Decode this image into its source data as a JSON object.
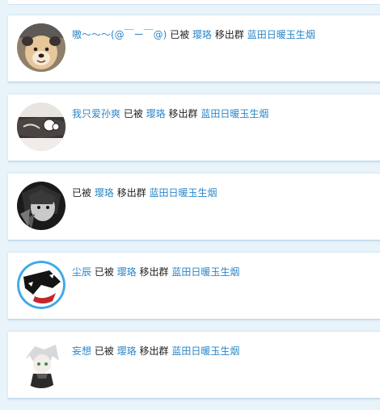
{
  "notifications": [
    {
      "user": "嗷～～～(@￣ー￣@)",
      "verb_removed": "已被",
      "admin": "璎珞",
      "action": "移出群",
      "group": "蓝田日暖玉生烟",
      "avatar": "dog-avatar"
    },
    {
      "user": "我只爱孙爽",
      "verb_removed": "已被",
      "admin": "璎珞",
      "action": "移出群",
      "group": "蓝田日暖玉生烟",
      "avatar": "anime-avatar"
    },
    {
      "user": "",
      "verb_removed": "已被",
      "admin": "璎珞",
      "action": "移出群",
      "group": "蓝田日暖玉生烟",
      "avatar": "dark-anime-avatar"
    },
    {
      "user": "尘辰",
      "verb_removed": "已被",
      "admin": "璎珞",
      "action": "移出群",
      "group": "蓝田日暖玉生烟",
      "avatar": "wolf-avatar"
    },
    {
      "user": "妄想",
      "verb_removed": "已被",
      "admin": "璎珞",
      "action": "移出群",
      "group": "蓝田日暖玉生烟",
      "avatar": "white-hair-avatar"
    }
  ],
  "colors": {
    "link": "#2a86c8",
    "background": "#e9f3fa",
    "card": "#ffffff"
  }
}
